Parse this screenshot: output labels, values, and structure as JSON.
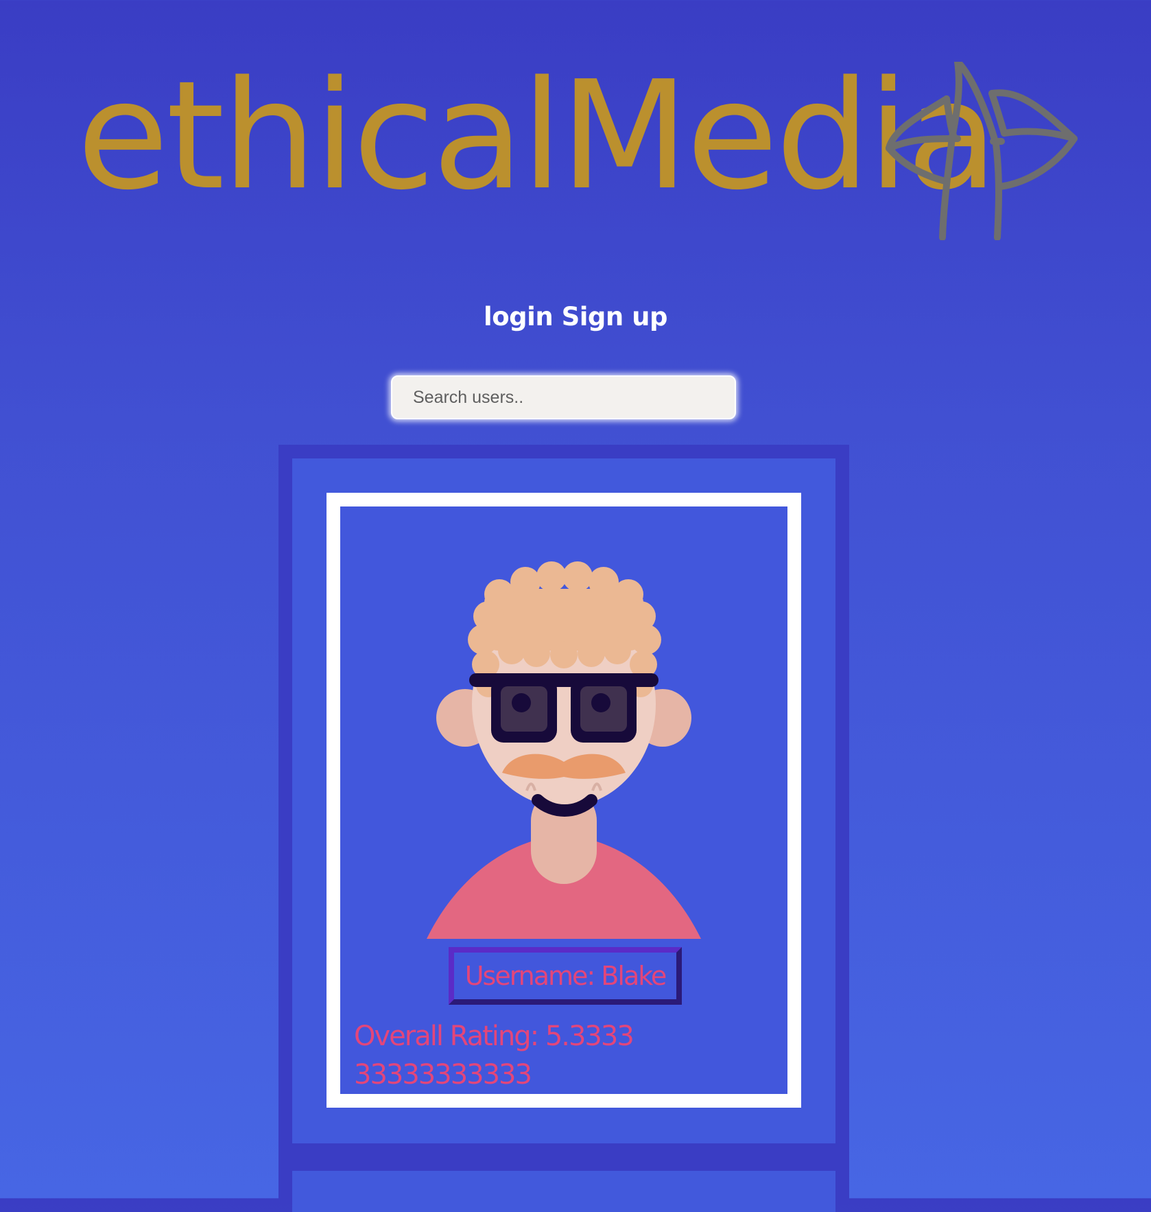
{
  "brand": {
    "name": "ethicalMedia",
    "logo_icon": "leaf-arrow-logo-icon",
    "text_color": "#bb902e",
    "logo_color": "#6e6e6e"
  },
  "nav": {
    "login_label": "login",
    "signup_label": "Sign up"
  },
  "search": {
    "placeholder": "Search users..",
    "value": ""
  },
  "profiles": [
    {
      "avatar": "curly-hair-sunglasses-mustache-avatar-icon",
      "username_label": "Username: Blake",
      "rating_label": "Overall Rating: 5.333333333333333"
    }
  ],
  "colors": {
    "page_background": "#3f49cc",
    "card_background": "#4259dc",
    "frame_border": "#ffffff",
    "accent_text": "#e3467a",
    "username_border": "#3f1fa6"
  }
}
